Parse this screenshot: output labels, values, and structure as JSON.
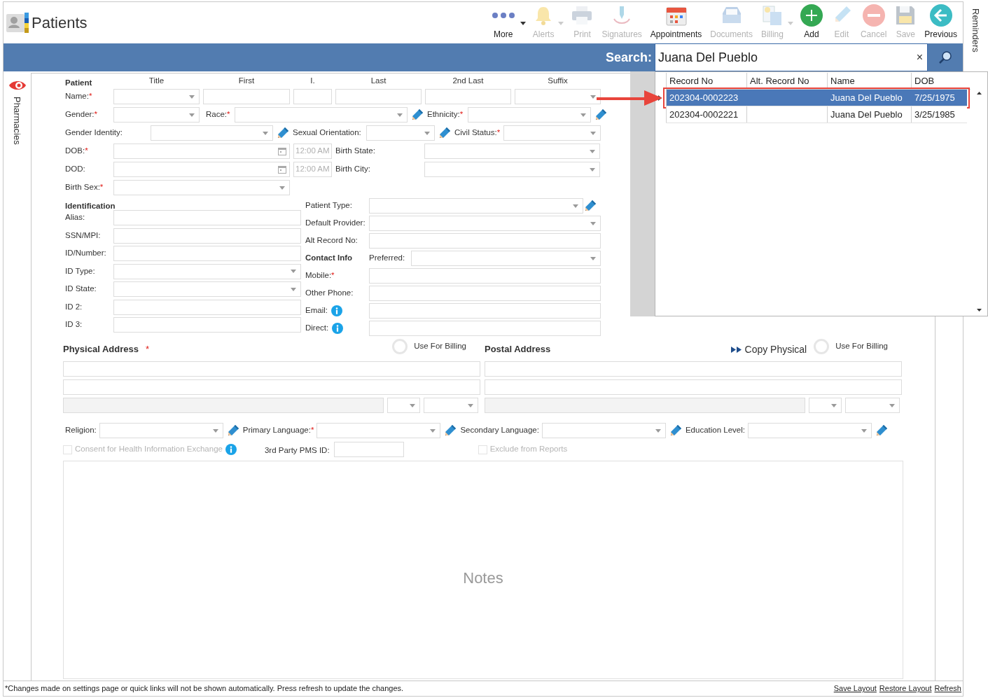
{
  "app": {
    "title": "Patients"
  },
  "toolbar": [
    {
      "label": "More",
      "disabled": false,
      "menu": true
    },
    {
      "label": "Alerts",
      "disabled": true,
      "menu": true
    },
    {
      "label": "Print",
      "disabled": true,
      "menu": false
    },
    {
      "label": "Signatures",
      "disabled": true,
      "menu": false
    },
    {
      "label": "Appointments",
      "disabled": false,
      "menu": false
    },
    {
      "label": "Documents",
      "disabled": true,
      "menu": false
    },
    {
      "label": "Billing",
      "disabled": true,
      "menu": true
    },
    {
      "label": "Add",
      "disabled": false,
      "menu": false
    },
    {
      "label": "Edit",
      "disabled": true,
      "menu": false
    },
    {
      "label": "Cancel",
      "disabled": true,
      "menu": false
    },
    {
      "label": "Save",
      "disabled": true,
      "menu": false
    },
    {
      "label": "Previous",
      "disabled": false,
      "menu": false
    }
  ],
  "reminders": "Reminders",
  "sidebar": {
    "label": "Pharmacies"
  },
  "search": {
    "label": "Search:",
    "value": "Juana Del Pueblo",
    "clear": "×"
  },
  "results": {
    "columns": [
      "Record No",
      "Alt. Record No",
      "Name",
      "DOB"
    ],
    "rows": [
      {
        "record_no": "202304-0002223",
        "name": "Juana Del Pueblo",
        "dob": "7/25/1975",
        "selected": true
      },
      {
        "record_no": "202304-0002221",
        "name": "Juana Del Pueblo",
        "dob": "3/25/1985",
        "selected": false
      }
    ]
  },
  "patient": {
    "heading": "Patient",
    "name_columns": [
      "Title",
      "First",
      "I.",
      "Last",
      "2nd Last",
      "Suffix"
    ],
    "name": {
      "label": "Name:",
      "required_mark": "*"
    },
    "gender": {
      "label": "Gender:",
      "required_mark": "*"
    },
    "race": {
      "label": "Race:",
      "required_mark": "*"
    },
    "ethnicity": {
      "label": "Ethnicity:",
      "required_mark": "*"
    },
    "gender_identity": {
      "label": "Gender Identity:"
    },
    "sexual_orientation": {
      "label": "Sexual Orientation:"
    },
    "civil_status": {
      "label": "Civil Status:",
      "required_mark": "*"
    },
    "dob": {
      "label": "DOB:",
      "required_mark": "*",
      "time": "12:00 AM"
    },
    "birth_state": {
      "label": "Birth State:"
    },
    "dod": {
      "label": "DOD:",
      "time": "12:00 AM"
    },
    "birth_city": {
      "label": "Birth City:"
    },
    "birth_sex": {
      "label": "Birth Sex:",
      "required_mark": "*"
    }
  },
  "identification": {
    "heading": "Identification",
    "fields": [
      {
        "label": "Alias:",
        "kind": "text"
      },
      {
        "label": "SSN/MPI:",
        "kind": "text"
      },
      {
        "label": "ID/Number:",
        "kind": "text"
      },
      {
        "label": "ID Type:",
        "kind": "select"
      },
      {
        "label": "ID State:",
        "kind": "select"
      },
      {
        "label": "ID 2:",
        "kind": "text"
      },
      {
        "label": "ID 3:",
        "kind": "text"
      }
    ]
  },
  "other": {
    "fields": [
      {
        "label": "Patient Type:",
        "kind": "select_edit"
      },
      {
        "label": "Default Provider:",
        "kind": "select"
      },
      {
        "label": "Alt Record No:",
        "kind": "text"
      }
    ]
  },
  "contact_info": {
    "heading": "Contact Info",
    "preferred_label": "Preferred:",
    "fields": [
      {
        "label": "Mobile:",
        "kind": "text",
        "required_mark": "*"
      },
      {
        "label": "Other Phone:",
        "kind": "text"
      },
      {
        "label": "Email:",
        "kind": "info_text"
      },
      {
        "label": "Direct:",
        "kind": "info_text"
      }
    ]
  },
  "physical_address": {
    "heading": "Physical Address",
    "required_mark": "*",
    "use_for_billing": {
      "label": "Use For Billing",
      "on": false
    }
  },
  "postal_address": {
    "heading": "Postal Address",
    "copy_label": "Copy Physical",
    "use_for_billing": {
      "label": "Use For Billing",
      "on": false
    }
  },
  "extra_fields": [
    {
      "label": "Religion:"
    },
    {
      "label": "Primary Language:",
      "required_mark": "*"
    },
    {
      "label": "Secondary Language:"
    },
    {
      "label": "Education Level:"
    }
  ],
  "consent": {
    "label": "Consent for Health Information Exchange",
    "checked": false,
    "disabled": true
  },
  "pms": {
    "label": "3rd Party PMS ID:"
  },
  "exclude": {
    "label": "Exclude from Reports",
    "checked": false,
    "disabled": true
  },
  "notes": {
    "placeholder": "Notes"
  },
  "footer": {
    "note": "*Changes made on settings page or quick links will not be shown automatically. Press refresh to update the changes.",
    "links": [
      "Save Layout",
      "Restore Layout",
      "Refresh"
    ]
  }
}
